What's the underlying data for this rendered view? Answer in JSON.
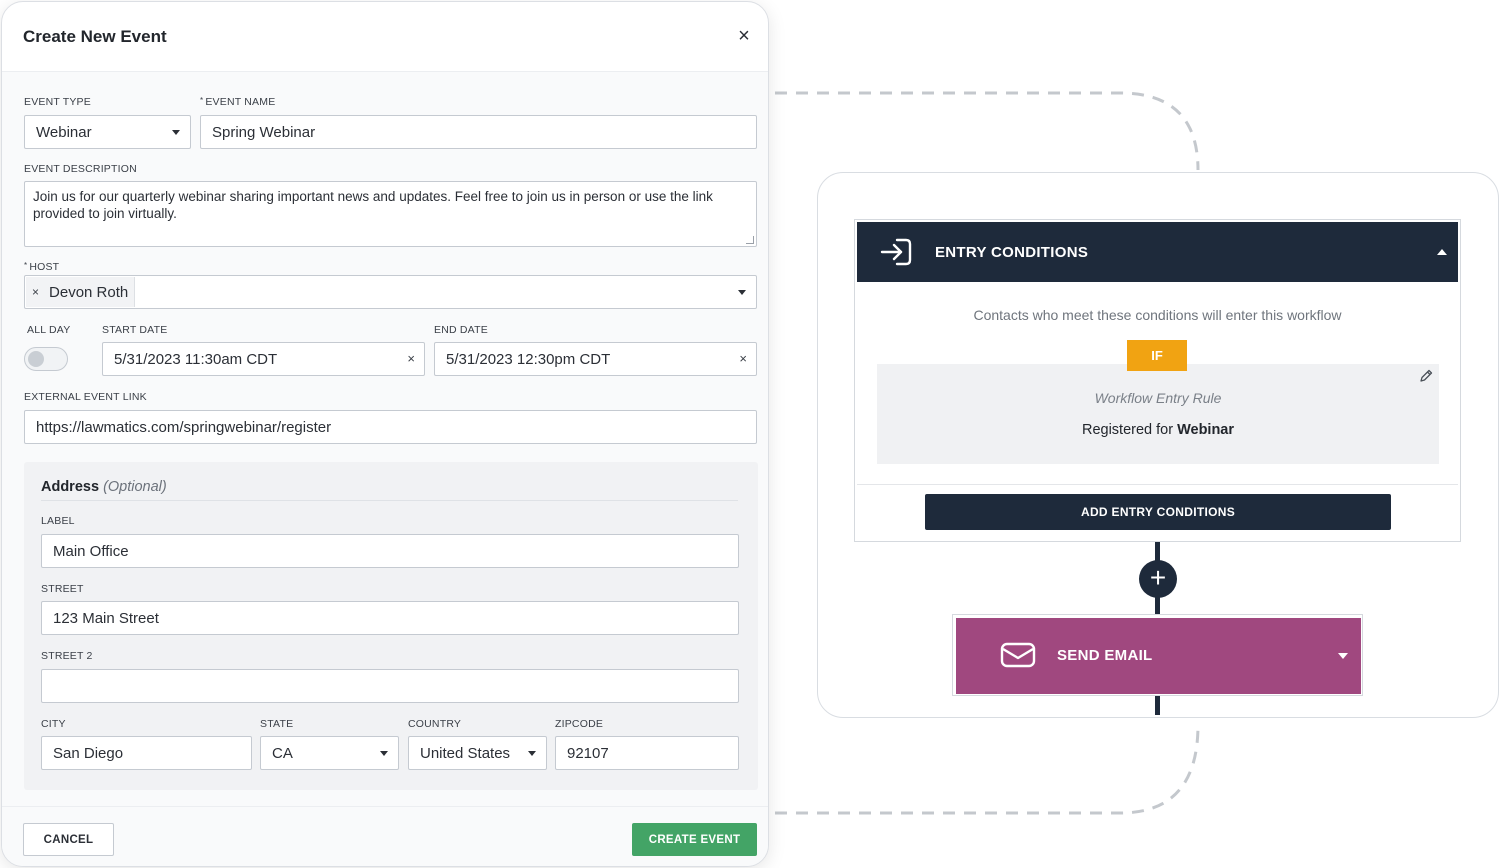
{
  "modal": {
    "title": "Create New Event",
    "close_icon": "close-icon",
    "event_type": {
      "label": "EVENT TYPE",
      "value": "Webinar"
    },
    "event_name": {
      "label": "EVENT NAME",
      "required_mark": "*",
      "value": "Spring Webinar"
    },
    "event_description": {
      "label": "EVENT DESCRIPTION",
      "value": "Join us for our quarterly webinar sharing important news and updates. Feel free to join us in person or use the link provided to join virtually."
    },
    "host": {
      "label": "HOST",
      "required_mark": "*",
      "tag_remove": "×",
      "value": "Devon Roth"
    },
    "all_day": {
      "label": "ALL DAY",
      "checked": false
    },
    "start_date": {
      "label": "START DATE",
      "value": "5/31/2023 11:30am CDT",
      "clear": "×"
    },
    "end_date": {
      "label": "END DATE",
      "value": "5/31/2023 12:30pm CDT",
      "clear": "×"
    },
    "external_link": {
      "label": "EXTERNAL EVENT LINK",
      "value": "https://lawmatics.com/springwebinar/register"
    },
    "address": {
      "title": "Address",
      "optional": "(Optional)",
      "label_field": {
        "label": "LABEL",
        "value": "Main Office"
      },
      "street": {
        "label": "STREET",
        "value": "123 Main Street"
      },
      "street2": {
        "label": "STREET 2",
        "value": ""
      },
      "city": {
        "label": "CITY",
        "value": "San Diego"
      },
      "state": {
        "label": "STATE",
        "value": "CA"
      },
      "country": {
        "label": "COUNTRY",
        "value": "United States"
      },
      "zipcode": {
        "label": "ZIPCODE",
        "value": "92107"
      }
    },
    "cancel_label": "CANCEL",
    "create_label": "CREATE EVENT"
  },
  "workflow": {
    "entry": {
      "title": "ENTRY CONDITIONS",
      "subtitle": "Contacts who meet these conditions will enter this workflow",
      "if_label": "IF",
      "rule_title": "Workflow Entry Rule",
      "rule_prefix": "Registered for",
      "rule_value": "Webinar",
      "add_label": "ADD ENTRY CONDITIONS"
    },
    "plus_label": "+",
    "send_email": {
      "title": "SEND EMAIL"
    }
  },
  "colors": {
    "navy": "#1e2a3b",
    "green": "#43a466",
    "amber": "#f1a312",
    "magenta": "#a0487f"
  }
}
